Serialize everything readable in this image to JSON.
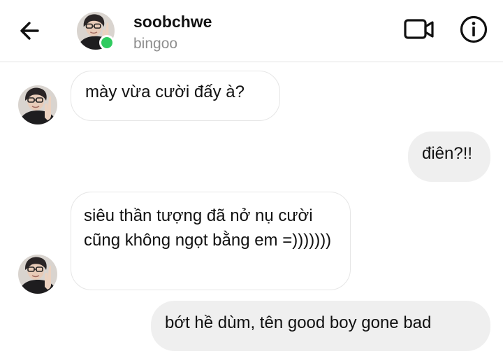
{
  "header": {
    "username": "soobchwe",
    "status": "bingoo"
  },
  "colors": {
    "online": "#2fcb5f",
    "incoming_bubble": "#ffffff",
    "outgoing_bubble": "#efefef",
    "secondary_text": "#8e8e8e"
  },
  "icons": [
    "back-arrow-icon",
    "video-call-icon",
    "info-icon"
  ],
  "messages": [
    {
      "direction": "incoming",
      "text": "mày vừa cười đấy à?"
    },
    {
      "direction": "outgoing",
      "text": "điên?!!"
    },
    {
      "direction": "incoming",
      "text": "siêu thần tượng đã nở nụ cười cũng không ngọt bằng em =)))))))"
    },
    {
      "direction": "outgoing",
      "text": "bớt hề dùm, tên good boy gone bad"
    }
  ]
}
